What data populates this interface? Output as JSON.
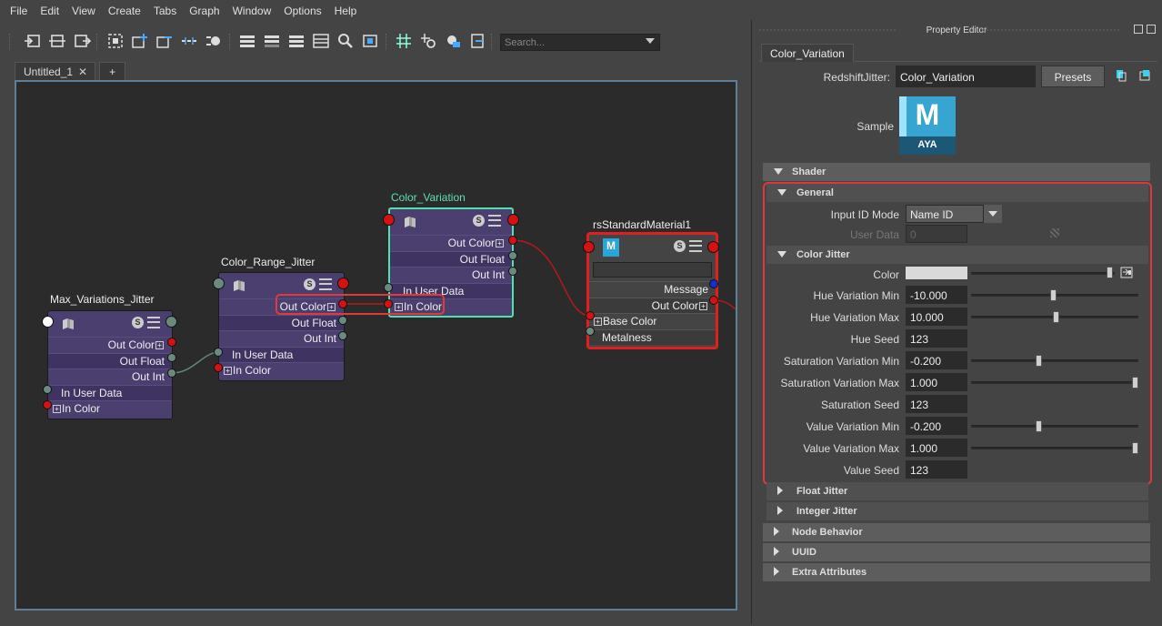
{
  "menu": [
    "File",
    "Edit",
    "View",
    "Create",
    "Tabs",
    "Graph",
    "Window",
    "Options",
    "Help"
  ],
  "toolbar": {
    "search_placeholder": "Search..."
  },
  "tabs": [
    {
      "label": "Untitled_1",
      "close": "✕"
    },
    {
      "label": "+"
    }
  ],
  "nodes": {
    "max_variations": {
      "title": "Max_Variations_Jitter",
      "rows": [
        "Out Color",
        "Out Float",
        "Out Int",
        "In User Data",
        "In Color"
      ]
    },
    "color_range": {
      "title": "Color_Range_Jitter",
      "rows": [
        "Out Color",
        "Out Float",
        "Out Int",
        "In User Data",
        "In Color"
      ]
    },
    "color_variation": {
      "title": "Color_Variation",
      "rows": [
        "Out Color",
        "Out Float",
        "Out Int",
        "In User Data",
        "In Color"
      ]
    },
    "material": {
      "title": "rsStandardMaterial1",
      "rows": [
        "Message",
        "Out Color",
        "Base Color",
        "Metalness"
      ]
    },
    "badge": "S"
  },
  "colors": {
    "node_purple": "#4b3f70",
    "port_red": "#d41212",
    "highlight_red": "#e0363c",
    "selected_green": "#52e0b0",
    "material_border": "#e02020"
  },
  "property_editor": {
    "title": "Property Editor",
    "tab": "Color_Variation",
    "node_type_label": "RedshiftJitter:",
    "node_name": "Color_Variation",
    "presets_label": "Presets",
    "sample_label": "Sample",
    "logo_letter": "M",
    "logo_text": "AYA",
    "sections": {
      "shader": "Shader",
      "general": "General",
      "color_jitter": "Color Jitter",
      "float_jitter": "Float Jitter",
      "integer_jitter": "Integer Jitter",
      "node_behavior": "Node Behavior",
      "uuid": "UUID",
      "extra": "Extra Attributes"
    },
    "general": {
      "input_id_mode_label": "Input ID Mode",
      "input_id_mode_value": "Name ID",
      "user_data_label": "User Data",
      "user_data_value": "0"
    },
    "color_jitter": {
      "color_label": "Color",
      "fields": [
        {
          "label": "Hue Variation Min",
          "value": "-10.000",
          "slider": 0.49
        },
        {
          "label": "Hue Variation Max",
          "value": "10.000",
          "slider": 0.51
        },
        {
          "label": "Hue Seed",
          "value": "123"
        },
        {
          "label": "Saturation Variation Min",
          "value": "-0.200",
          "slider": 0.4
        },
        {
          "label": "Saturation Variation Max",
          "value": "1.000",
          "slider": 1.0
        },
        {
          "label": "Saturation Seed",
          "value": "123"
        },
        {
          "label": "Value Variation Min",
          "value": "-0.200",
          "slider": 0.4
        },
        {
          "label": "Value Variation Max",
          "value": "1.000",
          "slider": 1.0
        },
        {
          "label": "Value Seed",
          "value": "123"
        }
      ]
    }
  }
}
